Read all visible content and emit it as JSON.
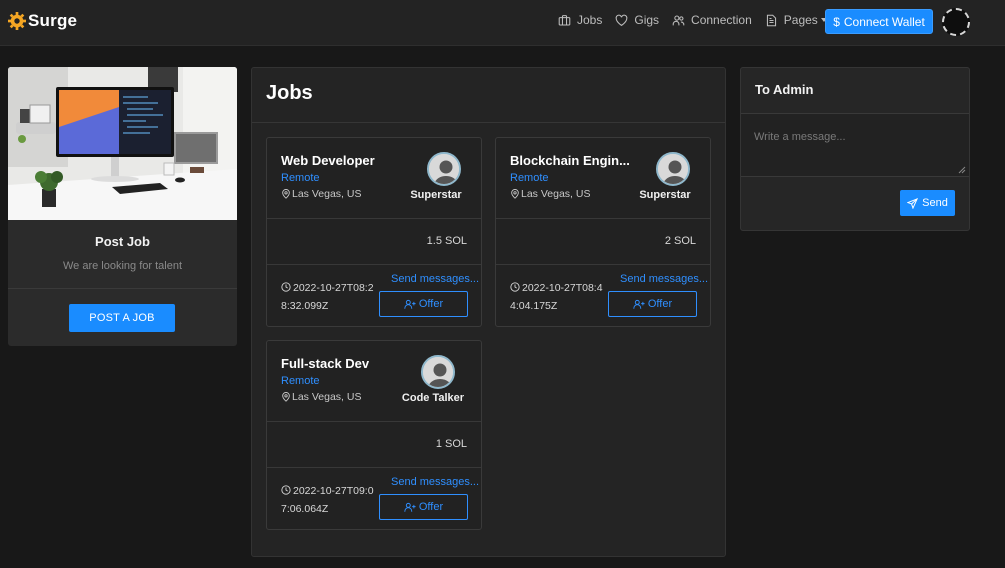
{
  "brand": {
    "name": "Surge",
    "icon": "gear-logo-icon",
    "accent": "#f5a623"
  },
  "nav": {
    "items": [
      {
        "label": "Jobs",
        "icon": "briefcase-icon"
      },
      {
        "label": "Gigs",
        "icon": "heart-icon"
      },
      {
        "label": "Connection",
        "icon": "users-icon"
      },
      {
        "label": "Pages",
        "icon": "document-icon"
      }
    ],
    "wallet_button": "Connect Wallet",
    "wallet_icon": "dollar-icon"
  },
  "post_job": {
    "title": "Post Job",
    "subtitle": "We are looking for talent",
    "button": "POST A JOB"
  },
  "jobs": {
    "title": "Jobs",
    "items": [
      {
        "title": "Web Developer",
        "type": "Remote",
        "location": "Las Vegas, US",
        "rank": "Superstar",
        "price": "1.5 SOL",
        "date": "2022-10-27T08:28:32.099Z",
        "send_label": "Send messages...",
        "offer_label": "Offer"
      },
      {
        "title": "Blockchain Engin...",
        "type": "Remote",
        "location": "Las Vegas, US",
        "rank": "Superstar",
        "price": "2 SOL",
        "date": "2022-10-27T08:44:04.175Z",
        "send_label": "Send messages...",
        "offer_label": "Offer"
      },
      {
        "title": "Full-stack Dev",
        "type": "Remote",
        "location": "Las Vegas, US",
        "rank": "Code Talker",
        "price": "1 SOL",
        "date": "2022-10-27T09:07:06.064Z",
        "send_label": "Send messages...",
        "offer_label": "Offer"
      }
    ]
  },
  "admin": {
    "title": "To Admin",
    "placeholder": "Write a message...",
    "send_label": "Send"
  },
  "colors": {
    "primary": "#1a8cff",
    "link": "#2f8fff",
    "background": "#181818",
    "card": "#222222"
  }
}
